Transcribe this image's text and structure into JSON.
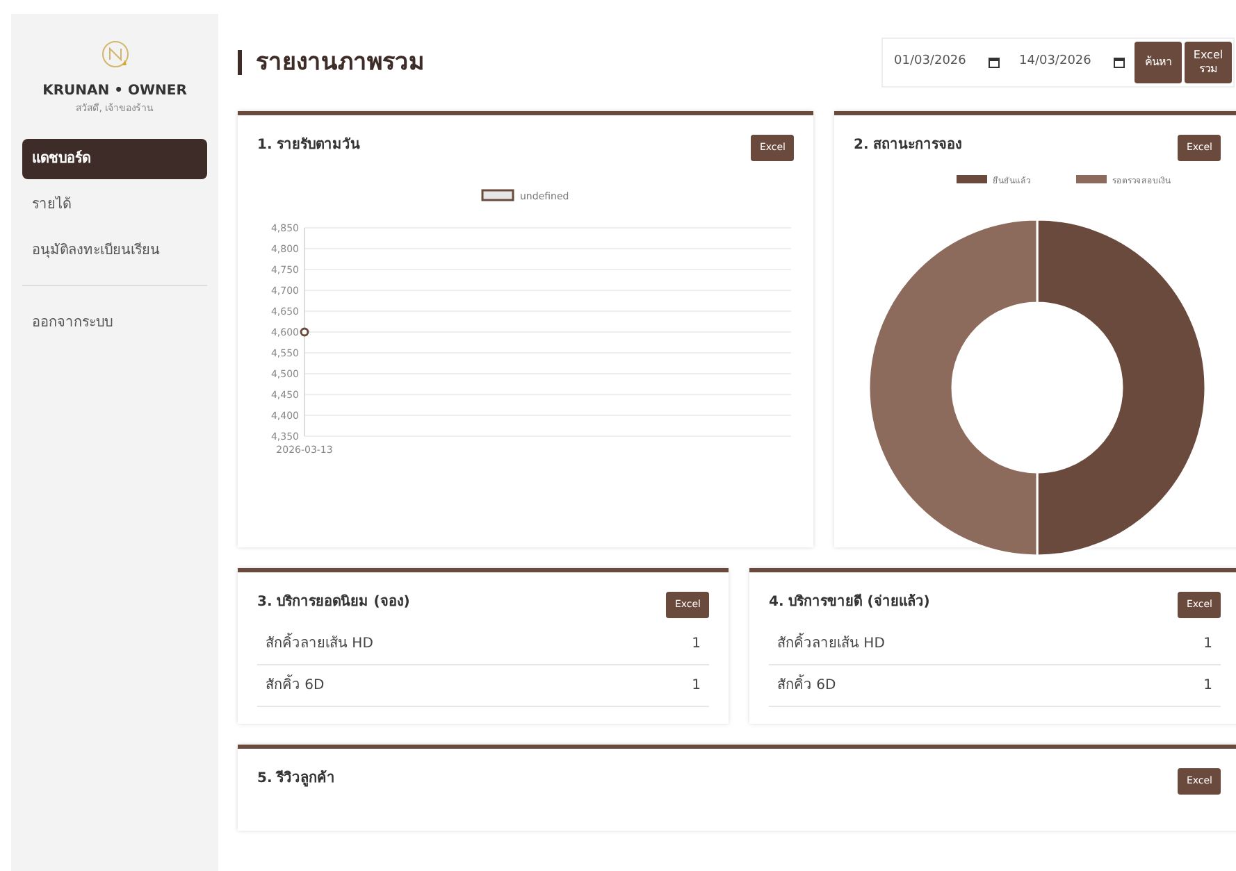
{
  "sidebar": {
    "brand": "KRUNAN • OWNER",
    "greeting": "สวัสดี, เจ้าของร้าน",
    "items": [
      {
        "label": "แดชบอร์ด",
        "selected": true
      },
      {
        "label": "รายได้",
        "selected": false
      },
      {
        "label": "อนุมัติลงทะเบียนเรียน",
        "selected": false
      }
    ],
    "logout": "ออกจากระบบ"
  },
  "header": {
    "title": "รายงานภาพรวม",
    "date_from": "01/03/2026",
    "date_to": "14/03/2026",
    "search_button": "ค้นหา",
    "export_button": [
      "Excel",
      "รวม"
    ]
  },
  "cards": [
    {
      "kind": "line",
      "title": "1. รายรับตามวัน",
      "button": "Excel",
      "chart_data": {
        "type": "line",
        "categories": [
          "2026-03-13"
        ],
        "series": [
          {
            "name": "undefined",
            "color": "#6b4a3e",
            "marker": "circle",
            "values": [
              4600
            ]
          }
        ],
        "grid": true,
        "legend": true,
        "ylim": [
          4350,
          4850
        ],
        "yticks": [
          {
            "value": 4350,
            "label": "4,350"
          },
          {
            "value": 4400,
            "label": "4,400"
          },
          {
            "value": 4450,
            "label": "4,450"
          },
          {
            "value": 4500,
            "label": "4,500"
          },
          {
            "value": 4550,
            "label": "4,550"
          },
          {
            "value": 4600,
            "label": "4,600"
          },
          {
            "value": 4650,
            "label": "4,650"
          },
          {
            "value": 4700,
            "label": "4,700"
          },
          {
            "value": 4750,
            "label": "4,750"
          },
          {
            "value": 4800,
            "label": "4,800"
          },
          {
            "value": 4850,
            "label": "4,850"
          }
        ]
      }
    },
    {
      "kind": "donut",
      "title": "2. สถานะการจอง",
      "button": "Excel",
      "chart_data": {
        "type": "donut",
        "categories": [
          "ยืนยันแล้ว",
          "รอตรวจสอบเงิน"
        ],
        "series": [
          {
            "values": [
              50,
              50
            ]
          }
        ],
        "legend": true,
        "colors": [
          "#6b4a3e",
          "#8c6b5d"
        ]
      }
    },
    {
      "kind": "list",
      "title": "3. บริการยอดนิยม (จอง)",
      "button": "Excel",
      "rows": [
        {
          "name": "สักคิ้วลายเส้น HD",
          "count": "1"
        },
        {
          "name": "สักคิ้ว 6D",
          "count": "1"
        }
      ]
    },
    {
      "kind": "list",
      "title": "4. บริการขายดี (จ่ายแล้ว)",
      "button": "Excel",
      "rows": [
        {
          "name": "สักคิ้วลายเส้น HD",
          "count": "1"
        },
        {
          "name": "สักคิ้ว 6D",
          "count": "1"
        }
      ]
    },
    {
      "kind": "empty",
      "title": "5. รีวิวลูกค้า",
      "button": "Excel"
    }
  ]
}
